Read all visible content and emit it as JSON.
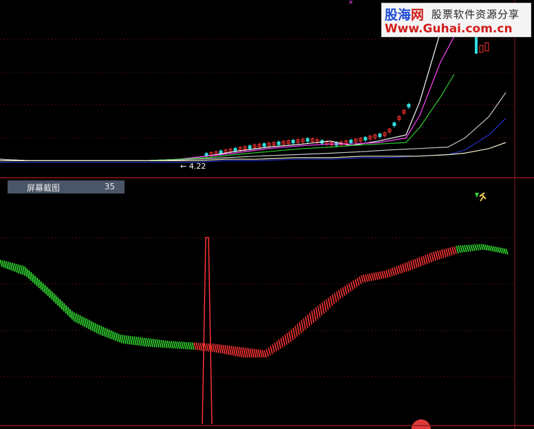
{
  "watermark": {
    "brand_a": "股海",
    "brand_b": "网",
    "tagline": "股票软件资源分享",
    "url": "Www.Guhai.com.cn"
  },
  "price_panel": {
    "low_marker": "← 4.22"
  },
  "indicator_label": {
    "title": "屏幕截图",
    "value": "35"
  },
  "colors": {
    "background": "#000000",
    "frame": "#8b1a1a",
    "grid": "#8b1a1a",
    "rise": "#ff3333",
    "fall": "#33dd33",
    "white_line": "#ffffff",
    "magenta_line": "#ff44ff",
    "green_line": "#33cc33",
    "silver_line": "#c8c8c8",
    "blue_line": "#2233cc",
    "cream_line": "#f5f0c8"
  },
  "chart_data": [
    {
      "type": "line",
      "note": "price chart with candlesticks and moving averages; no axis scale visible",
      "price_low_label": "4.22",
      "series": [
        {
          "color": "white",
          "values": [
            0.04,
            0.03,
            0.03,
            0.03,
            0.03,
            0.04,
            0.06,
            0.09,
            0.12,
            0.14,
            0.16,
            0.13,
            0.16,
            0.2,
            0.42,
            0.88,
            1.0
          ]
        },
        {
          "color": "magenta",
          "values": [
            0.04,
            0.03,
            0.03,
            0.03,
            0.03,
            0.04,
            0.06,
            0.08,
            0.11,
            0.13,
            0.14,
            0.14,
            0.15,
            0.18,
            0.33,
            0.68,
            0.85
          ]
        },
        {
          "color": "green",
          "values": [
            0.04,
            0.03,
            0.03,
            0.03,
            0.03,
            0.04,
            0.05,
            0.07,
            0.09,
            0.11,
            0.12,
            0.13,
            0.14,
            0.15,
            0.25,
            0.45,
            0.6
          ]
        },
        {
          "color": "silver",
          "values": [
            0.04,
            0.03,
            0.03,
            0.03,
            0.03,
            0.04,
            0.05,
            0.06,
            0.07,
            0.08,
            0.09,
            0.1,
            0.11,
            0.12,
            0.18,
            0.32,
            0.48
          ]
        },
        {
          "color": "blue",
          "values": [
            0.02,
            0.02,
            0.02,
            0.02,
            0.02,
            0.02,
            0.03,
            0.03,
            0.04,
            0.04,
            0.05,
            0.05,
            0.06,
            0.07,
            0.1,
            0.2,
            0.31
          ]
        },
        {
          "color": "cream",
          "values": [
            0.03,
            0.03,
            0.03,
            0.03,
            0.03,
            0.03,
            0.04,
            0.04,
            0.05,
            0.05,
            0.06,
            0.06,
            0.06,
            0.07,
            0.08,
            0.11,
            0.15
          ]
        }
      ]
    },
    {
      "type": "area",
      "note": "oscillator band; green = falling, red = rising; single spike signal",
      "upper": [
        0.74,
        0.7,
        0.56,
        0.41,
        0.33,
        0.26,
        0.24,
        0.22,
        0.21,
        0.2,
        0.18,
        0.16,
        0.28,
        0.42,
        0.54,
        0.64,
        0.67,
        0.73,
        0.79,
        0.83,
        0.84,
        0.81
      ],
      "lower": [
        0.72,
        0.66,
        0.52,
        0.37,
        0.29,
        0.23,
        0.21,
        0.2,
        0.19,
        0.17,
        0.14,
        0.14,
        0.24,
        0.37,
        0.51,
        0.62,
        0.65,
        0.7,
        0.76,
        0.81,
        0.83,
        0.8
      ],
      "signal_spike_index": 11
    }
  ]
}
